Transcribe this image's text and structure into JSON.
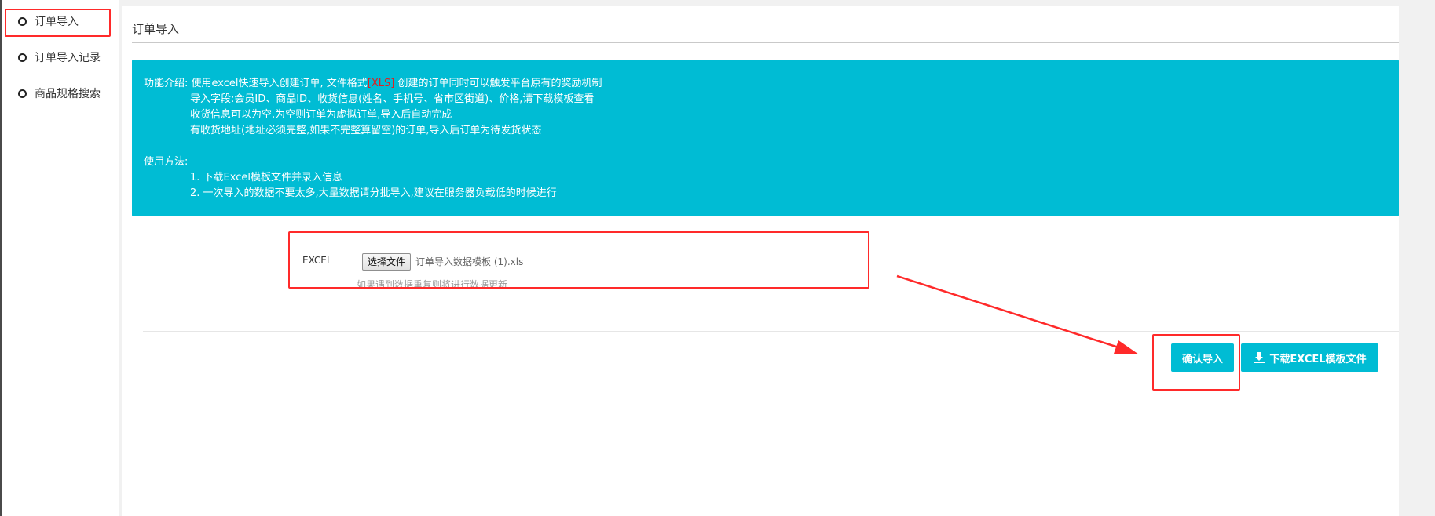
{
  "sidebar": {
    "items": [
      {
        "label": "订单导入"
      },
      {
        "label": "订单导入记录"
      },
      {
        "label": "商品规格搜索"
      }
    ]
  },
  "page": {
    "title": "订单导入"
  },
  "info": {
    "intro_prefix": "功能介绍: 使用excel快速导入创建订单, 文件格式",
    "format": "[XLS]",
    "intro_suffix": " 创建的订单同时可以触发平台原有的奖励机制",
    "line2": "导入字段:会员ID、商品ID、收货信息(姓名、手机号、省市区街道)、价格,请下载模板查看",
    "line3": "收货信息可以为空,为空则订单为虚拟订单,导入后自动完成",
    "line4": "有收货地址(地址必须完整,如果不完整算留空)的订单,导入后订单为待发货状态",
    "usage_title": "使用方法:",
    "step1": "1. 下载Excel模板文件并录入信息",
    "step2": "2. 一次导入的数据不要太多,大量数据请分批导入,建议在服务器负载低的时候进行"
  },
  "form": {
    "label": "EXCEL",
    "file_button": "选择文件",
    "file_name": "订单导入数据模板 (1).xls",
    "help": "如果遇到数据重复则将进行数据更新"
  },
  "actions": {
    "confirm_label": "确认导入",
    "download_label": "下载EXCEL模板文件"
  },
  "colors": {
    "accent": "#00bcd4",
    "annotation": "#ff2a2a",
    "format_text": "#e02020"
  },
  "icons": {
    "sidebar_bullet": "circle-outline-icon",
    "download": "download-icon"
  }
}
